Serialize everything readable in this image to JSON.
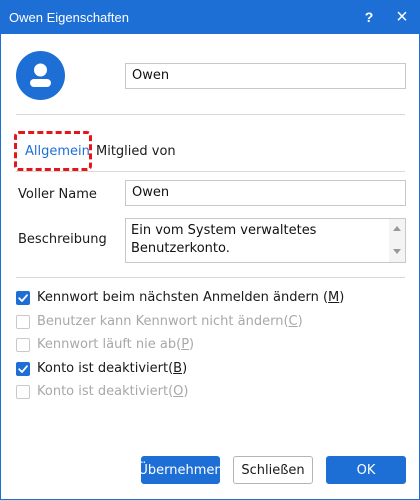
{
  "window": {
    "title": "Owen Eigenschaften",
    "help_glyph": "?",
    "close_glyph": "×"
  },
  "user": {
    "name_value": "Owen"
  },
  "tabs": [
    {
      "label": "Allgemein",
      "active": true
    },
    {
      "label": "Mitglied von",
      "active": false
    }
  ],
  "fields": {
    "full_name_label": "Voller Name",
    "full_name_value": "Owen",
    "description_label": "Beschreibung",
    "description_value": "Ein vom System verwaltetes Benutzerkonto."
  },
  "checkboxes": [
    {
      "text": "Kennwort beim nächsten Anmelden ändern (",
      "key": "M",
      "close": ")",
      "checked": true,
      "enabled": true
    },
    {
      "text": "Benutzer kann Kennwort nicht ändern(",
      "key": "C",
      "close": ")",
      "checked": false,
      "enabled": false
    },
    {
      "text": "Kennwort läuft nie ab(",
      "key": "P",
      "close": ")",
      "checked": false,
      "enabled": false
    },
    {
      "text": "Konto ist deaktiviert(",
      "key": "B",
      "close": ")",
      "checked": true,
      "enabled": true
    },
    {
      "text": "Konto ist deaktiviert(",
      "key": "O",
      "close": ")",
      "checked": false,
      "enabled": false
    }
  ],
  "buttons": {
    "apply": "Übernehmen",
    "close": "Schließen",
    "ok": "OK"
  },
  "colors": {
    "accent": "#1d6fd6",
    "highlight": "#e4161c"
  },
  "icons": {
    "avatar": "user-avatar-icon",
    "help": "help-icon",
    "close": "close-icon",
    "check": "checkmark-icon"
  }
}
